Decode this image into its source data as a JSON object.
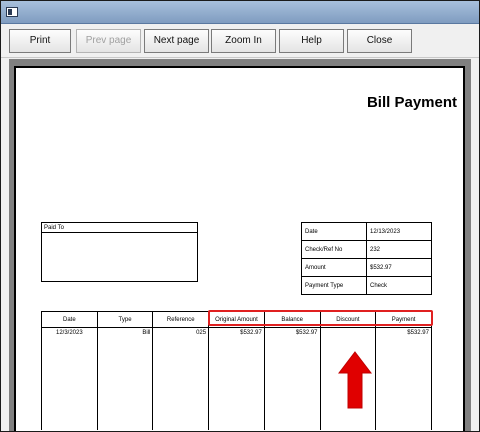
{
  "toolbar": {
    "buttons": [
      "Print",
      "Prev page",
      "Next page",
      "Zoom In",
      "Help",
      "Close"
    ]
  },
  "document": {
    "title": "Bill Payment",
    "paid_to_label": "Paid To",
    "info": [
      {
        "label": "Date",
        "value": "12/13/2023"
      },
      {
        "label": "Check/Ref No",
        "value": "232"
      },
      {
        "label": "Amount",
        "value": "$532.97"
      },
      {
        "label": "Payment Type",
        "value": "Check"
      }
    ],
    "table": {
      "headers": [
        "Date",
        "Type",
        "Reference",
        "Original Amount",
        "Balance",
        "Discount",
        "Payment"
      ],
      "row": [
        "12/3/2023",
        "Bill",
        "025",
        "$532.97",
        "$532.97",
        "",
        "$532.97"
      ]
    }
  },
  "colors": {
    "highlight": "#e02020",
    "arrow": "#e00000"
  }
}
